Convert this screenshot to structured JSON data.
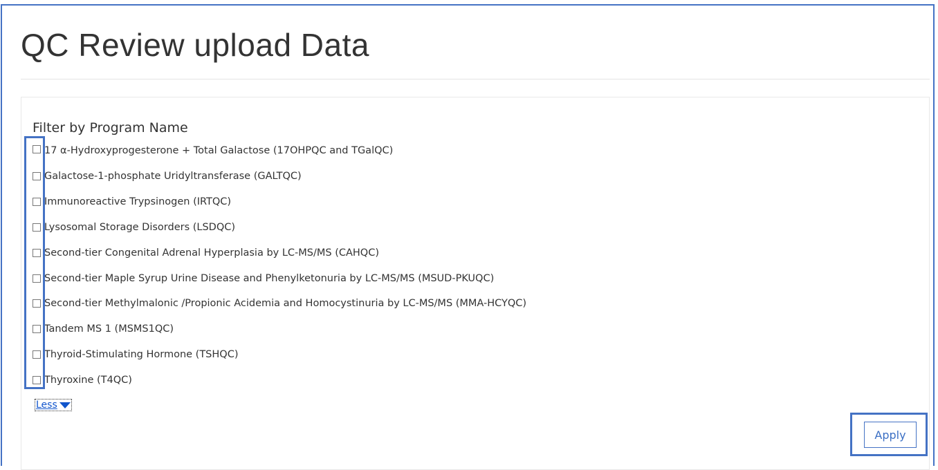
{
  "page": {
    "title": "QC Review upload Data"
  },
  "filter": {
    "heading": "Filter by Program Name",
    "programs": [
      {
        "label": "17 α-Hydroxyprogesterone + Total Galactose (17OHPQC and TGalQC)",
        "checked": false
      },
      {
        "label": "Galactose-1-phosphate Uridyltransferase (GALTQC)",
        "checked": false
      },
      {
        "label": "Immunoreactive Trypsinogen (IRTQC)",
        "checked": false
      },
      {
        "label": "Lysosomal Storage Disorders (LSDQC)",
        "checked": false
      },
      {
        "label": "Second-tier Congenital Adrenal Hyperplasia by LC-MS/MS (CAHQC)",
        "checked": false
      },
      {
        "label": "Second-tier Maple Syrup Urine Disease and Phenylketonuria by LC-MS/MS (MSUD-PKUQC)",
        "checked": false
      },
      {
        "label": "Second-tier Methylmalonic /Propionic Acidemia and Homocystinuria by LC-MS/MS (MMA-HCYQC)",
        "checked": false
      },
      {
        "label": "Tandem MS 1 (MSMS1QC)",
        "checked": false
      },
      {
        "label": "Thyroid-Stimulating Hormone (TSHQC)",
        "checked": false
      },
      {
        "label": "Thyroxine (T4QC)",
        "checked": false
      }
    ],
    "toggle_label": "Less",
    "toggle_icon": "caret-down-icon",
    "apply_label": "Apply"
  },
  "colors": {
    "highlight": "#4472c4",
    "link": "#1155cc",
    "text": "#333333"
  }
}
